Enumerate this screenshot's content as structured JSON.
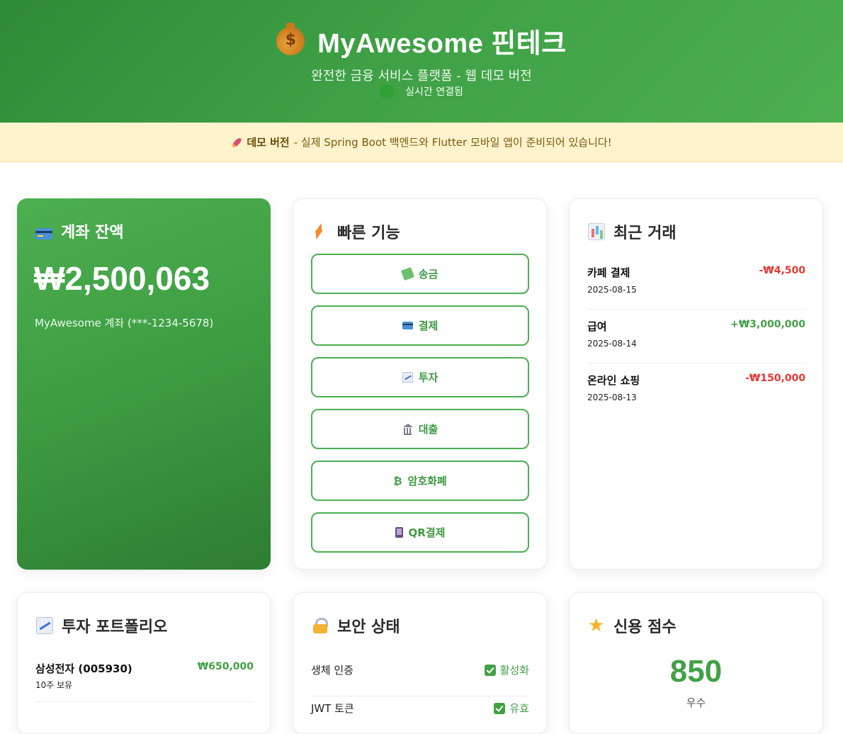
{
  "header": {
    "title": "MyAwesome 핀테크",
    "subtitle": "완전한 금융 서비스 플랫폼 - 웹 데모 버전",
    "connection_status": "실시간 연결됨",
    "money_icon": "money-bag-icon"
  },
  "banner": {
    "icon": "rocket-icon",
    "bold": "데모 버전",
    "text": "- 실제 Spring Boot 백엔드와 Flutter 모바일 앱이 준비되어 있습니다!"
  },
  "balance": {
    "title": "계좌 잔액",
    "amount": "₩2,500,063",
    "account": "MyAwesome 계좌 (***-1234-5678)"
  },
  "quick": {
    "title": "빠른 기능",
    "buttons": [
      {
        "label": "송금",
        "icon": "money-with-wings-icon"
      },
      {
        "label": "결제",
        "icon": "credit-card-icon"
      },
      {
        "label": "투자",
        "icon": "chart-increasing-icon"
      },
      {
        "label": "대출",
        "icon": "bank-icon"
      },
      {
        "label": "암호화폐",
        "icon": "bitcoin-icon",
        "glyph": "₿"
      },
      {
        "label": "QR결제",
        "icon": "mobile-phone-icon"
      }
    ]
  },
  "transactions": {
    "title": "최근 거래",
    "items": [
      {
        "name": "카페 결제",
        "date": "2025-08-15",
        "amount": "-₩4,500",
        "type": "negative"
      },
      {
        "name": "급여",
        "date": "2025-08-14",
        "amount": "+₩3,000,000",
        "type": "positive"
      },
      {
        "name": "온라인 쇼핑",
        "date": "2025-08-13",
        "amount": "-₩150,000",
        "type": "negative"
      }
    ]
  },
  "portfolio": {
    "title": "투자 포트폴리오",
    "items": [
      {
        "name": "삼성전자 (005930)",
        "holding": "10주 보유",
        "value": "₩650,000"
      }
    ]
  },
  "security": {
    "title": "보안 상태",
    "items": [
      {
        "label": "생체 인증",
        "status": "활성화"
      },
      {
        "label": "JWT 토큰",
        "status": "유효"
      }
    ]
  },
  "credit": {
    "title": "신용 점수",
    "score": "850",
    "grade": "우수"
  },
  "colors": {
    "primary_green": "#4caf50",
    "positive": "#43a047",
    "negative": "#e53935",
    "banner_bg": "#fff3cd"
  }
}
